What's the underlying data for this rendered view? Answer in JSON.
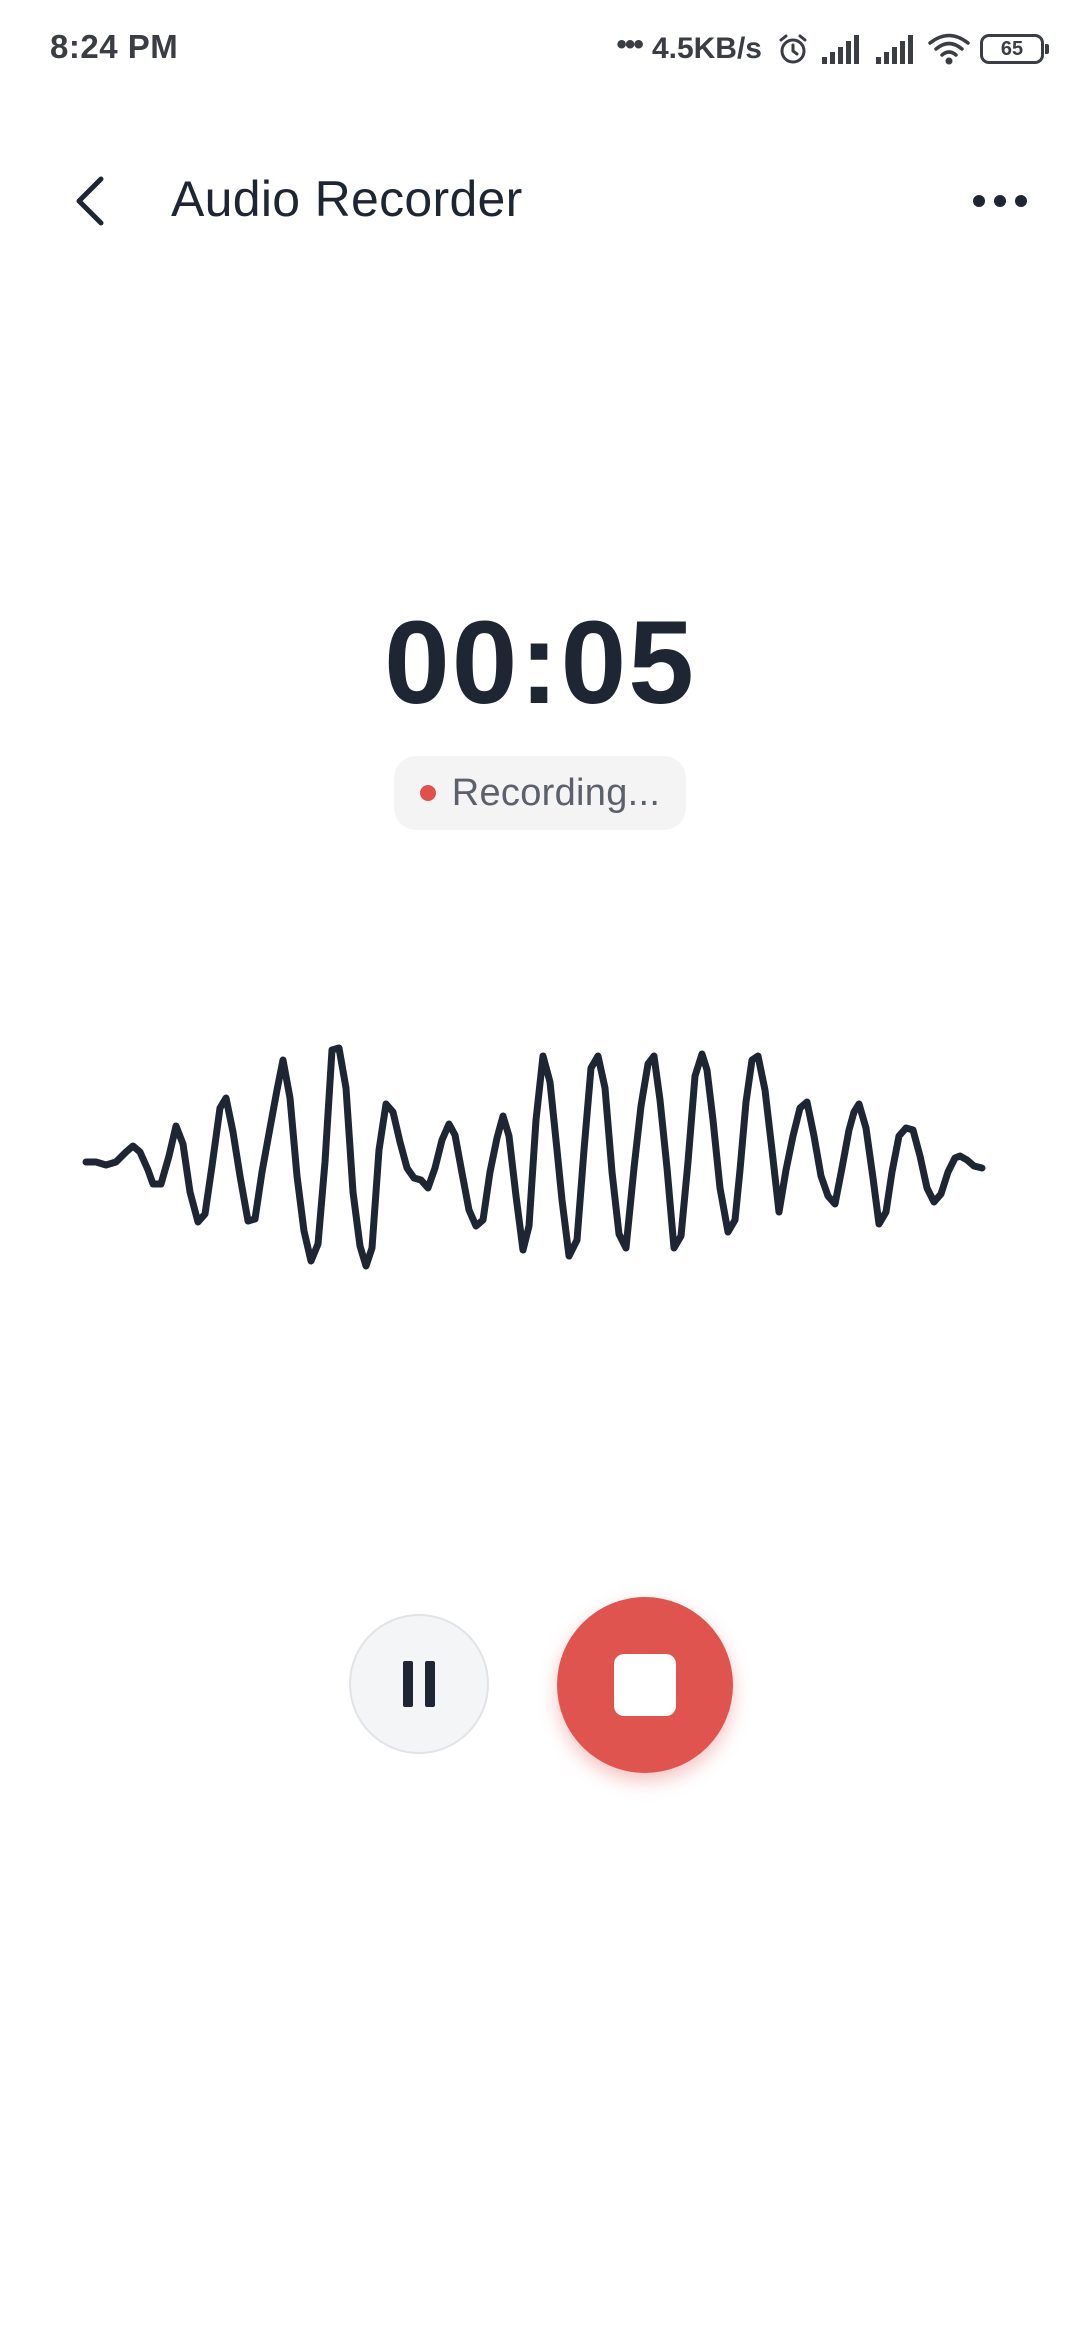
{
  "status_bar": {
    "time": "8:24 PM",
    "network_speed": "4.5KB/s",
    "battery_level": "65",
    "icons": [
      "more-notifications-icon",
      "alarm-icon",
      "signal-icon",
      "signal-icon",
      "wifi-icon",
      "battery-icon"
    ]
  },
  "app_bar": {
    "title": "Audio Recorder",
    "back_icon": "chevron-left-icon",
    "menu_icon": "more-horizontal-icon"
  },
  "recorder": {
    "elapsed_time": "00:05",
    "status_text": "Recording...",
    "waveform_icon": "audio-waveform"
  },
  "controls": {
    "pause_icon": "pause-icon",
    "stop_icon": "stop-icon"
  },
  "colors": {
    "text_primary": "#1f2633",
    "text_secondary": "#5b606b",
    "accent_red": "#e0544f",
    "pill_background": "#f4f4f5",
    "pause_background": "#f4f5f7"
  }
}
